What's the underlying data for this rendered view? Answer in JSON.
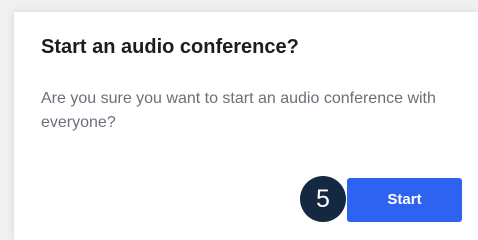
{
  "dialog": {
    "title": "Start an audio conference?",
    "message": "Are you sure you want to start an audio conference with everyone?",
    "step_badge": "5",
    "start_label": "Start"
  },
  "colors": {
    "primary_button": "#2e62f0",
    "badge_background": "#142842",
    "title_text": "#1c1c22",
    "message_text": "#6b6f7a"
  }
}
